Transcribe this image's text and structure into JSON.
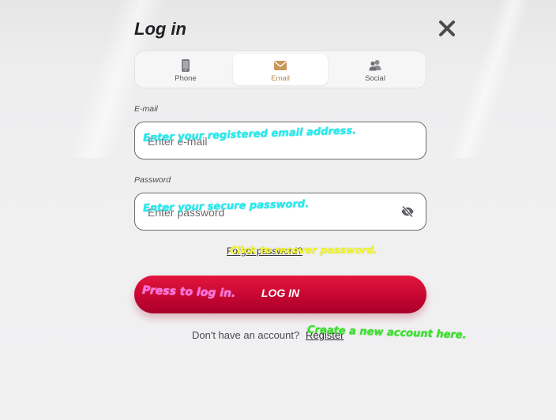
{
  "modal": {
    "title": "Log in",
    "close_icon": "close-icon"
  },
  "tabs": [
    {
      "label": "Phone",
      "icon": "phone-icon",
      "active": false
    },
    {
      "label": "Email",
      "icon": "email-icon",
      "active": true
    },
    {
      "label": "Social",
      "icon": "social-icon",
      "active": false
    }
  ],
  "email": {
    "label": "E-mail",
    "placeholder": "Enter e-mail",
    "hint": "Enter your registered email address."
  },
  "password": {
    "label": "Password",
    "placeholder": "Enter password",
    "hint": "Enter your secure password.",
    "toggle_icon": "eye-off-icon"
  },
  "forgot": {
    "label": "Forgot password?",
    "hint": "Click to recover password."
  },
  "login_button": {
    "label": "LOG IN",
    "hint": "Press to log in."
  },
  "signup": {
    "text": "Don't have an account?",
    "link": "Register",
    "hint": "Create a new account here."
  },
  "colors": {
    "accent": "#c60632",
    "active_tab_text": "#b5894a",
    "hint_cyan": "#22eef2",
    "hint_yellow": "#f4f82a",
    "hint_pink": "#ff6ee8",
    "hint_green": "#3be32a"
  }
}
